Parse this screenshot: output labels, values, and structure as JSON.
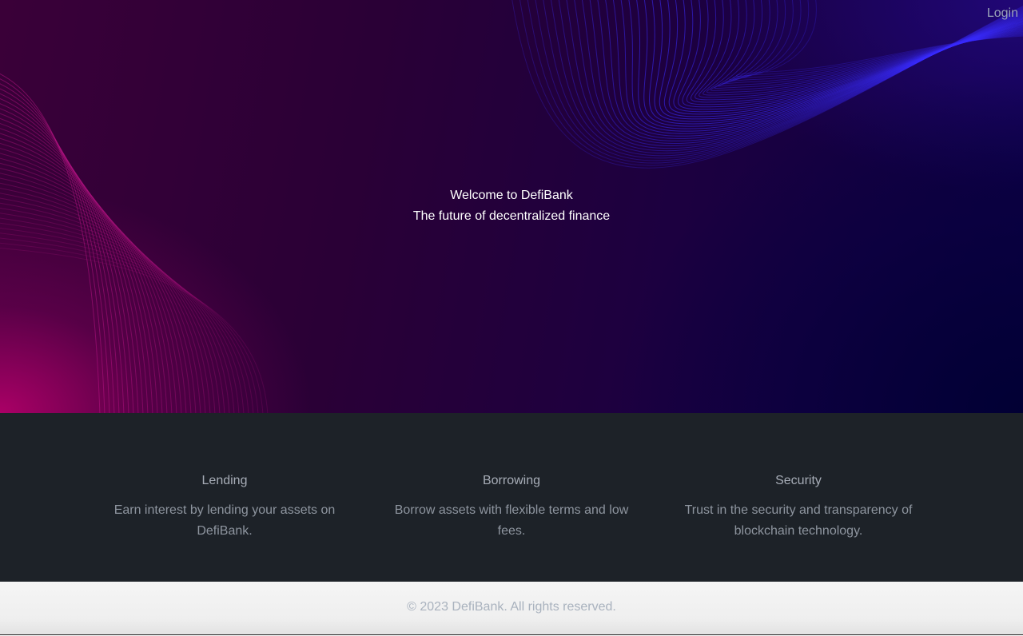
{
  "nav": {
    "login_label": "Login"
  },
  "hero": {
    "title": "Welcome to DefiBank",
    "subtitle": "The future of decentralized finance"
  },
  "features": [
    {
      "title": "Lending",
      "description": "Earn interest by lending your assets on DefiBank."
    },
    {
      "title": "Borrowing",
      "description": "Borrow assets with flexible terms and low fees."
    },
    {
      "title": "Security",
      "description": "Trust in the security and transparency of blockchain technology."
    }
  ],
  "footer": {
    "copyright": "© 2023 DefiBank. All rights reserved."
  },
  "colors": {
    "hero_left": "#3a0038",
    "hero_right": "#0c0045",
    "wave_blue": "#3a2cff",
    "wave_pink": "#c0158a",
    "features_bg": "#1d2228",
    "footer_bg": "#f5f5f5"
  }
}
